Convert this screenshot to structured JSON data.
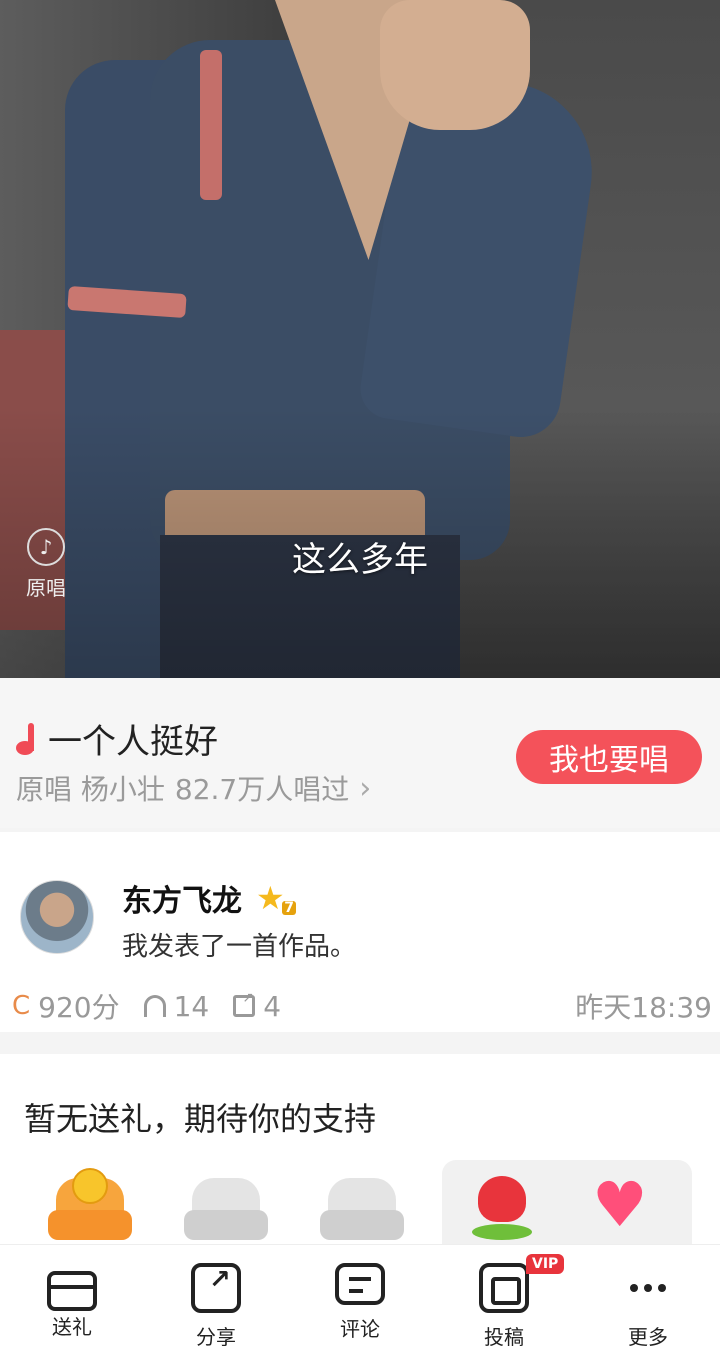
{
  "video": {
    "original_label": "原唱",
    "lyric": "这么多年"
  },
  "song": {
    "title": "一个人挺好",
    "meta_original": "原唱 杨小壮",
    "meta_count": "82.7万人唱过",
    "sing_button": "我也要唱"
  },
  "post": {
    "username": "东方飞龙",
    "level": "7",
    "text": "我发表了一首作品。",
    "score": "920分",
    "listens": "14",
    "shares": "4",
    "time": "昨天18:39"
  },
  "gifts": {
    "empty_text": "暂无送礼，期待你的支持"
  },
  "tabbar": {
    "gift": "送礼",
    "share": "分享",
    "comment": "评论",
    "post": "投稿",
    "vip_badge": "VIP",
    "more": "更多"
  },
  "colors": {
    "accent": "#f4525a",
    "note": "#f04b56",
    "vip": "#e8343c"
  }
}
